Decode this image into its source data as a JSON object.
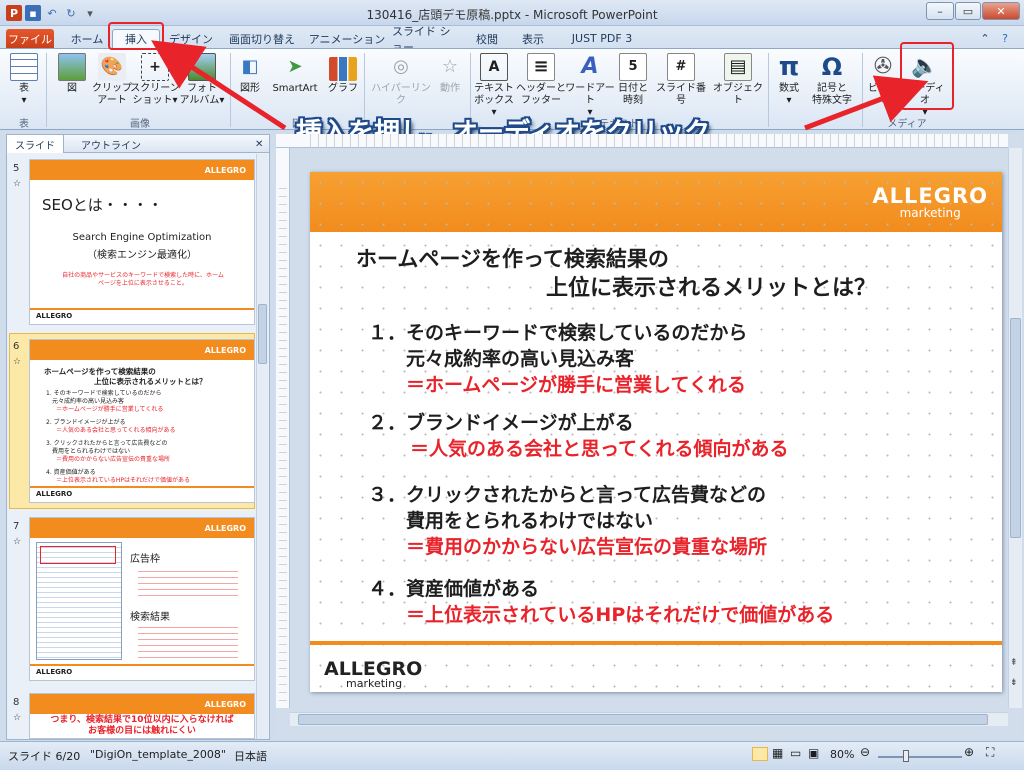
{
  "window": {
    "title": "130416_店頭デモ原稿.pptx  -  Microsoft PowerPoint"
  },
  "tabs": [
    "ファイル",
    "ホーム",
    "挿入",
    "デザイン",
    "画面切り替え",
    "アニメーション",
    "スライド ショー",
    "校閲",
    "表示",
    "JUST PDF 3"
  ],
  "ribbon": {
    "buttons": {
      "table": "表",
      "picture": "図",
      "clipart": "クリップ\nアート",
      "screenshot": "スクリーン\nショット▾",
      "photoalbum": "フォト\nアルバム▾",
      "shapes": "図形",
      "smartart": "SmartArt",
      "chart": "グラフ",
      "hyperlink": "ハイパーリンク",
      "action": "動作",
      "textbox": "テキスト\nボックス▾",
      "headerfooter": "ヘッダーと\nフッター",
      "wordart": "ワードアート\n▾",
      "datetime": "日付と\n時刻",
      "slidenumber": "スライド番号",
      "object": "オブジェクト",
      "equation": "数式\n▾",
      "symbol": "記号と\n特殊文字",
      "video": "ビデオ\n▾",
      "audio": "オーディオ\n▾"
    },
    "groups": {
      "table": "表",
      "images": "画像",
      "illustrations": "図",
      "links": "リンク",
      "text": "テキスト",
      "symbols": "記号と特殊文字",
      "media": "メディア"
    }
  },
  "callout": "挿入を押し、オーディオをクリック",
  "pane": {
    "tabs": [
      "スライド",
      "アウトライン"
    ],
    "thumbs": [
      {
        "num": "5",
        "title": "SEOとは・・・・",
        "sub1": "Search Engine Optimization",
        "sub2": "（検索エンジン最適化）",
        "red": "自社の商品やサービスのキーワードで検索した時に、ホームページを上位に表示させること。"
      },
      {
        "num": "6",
        "title": "ホームページを作って検索結果の",
        "title2": "上位に表示されるメリットとは？",
        "l1": "1. そのキーワードで検索しているのだから",
        "l1b": "元々成約率の高い見込み客",
        "l1r": "＝ホームページが勝手に営業してくれる",
        "l2": "2. ブランドイメージが上がる",
        "l2r": "＝人気のある会社と思ってくれる傾向がある",
        "l3": "3. クリックされたからと言って広告費などの",
        "l3b": "費用をとられるわけではない",
        "l3r": "＝費用のかからない広告宣伝の貴重な場所",
        "l4": "4. 資産価値がある",
        "l4r": "＝上位表示されているHPはそれだけで価値がある"
      },
      {
        "num": "7",
        "ad": "広告枠",
        "search": "検索結果"
      },
      {
        "num": "8",
        "red": "つまり、検索結果で10位以内に入らなければ",
        "red2": "お客様の目には触れにくい"
      }
    ]
  },
  "slide": {
    "logo": "ALLEGRO",
    "logo_sub": "marketing",
    "title1": "ホームページを作って検索結果の",
    "title2": "上位に表示されるメリットとは？",
    "items": [
      {
        "l1": "１．そのキーワードで検索しているのだから",
        "l2": "元々成約率の高い見込み客",
        "r": "＝ホームページが勝手に営業してくれる"
      },
      {
        "l1": "２．ブランドイメージが上がる",
        "r": "＝人気のある会社と思ってくれる傾向がある"
      },
      {
        "l1": "３．クリックされたからと言って広告費などの",
        "l2": "費用をとられるわけではない",
        "r": "＝費用のかからない広告宣伝の貴重な場所"
      },
      {
        "l1": "４．資産価値がある",
        "r": "＝上位表示されているHPはそれだけで価値がある"
      }
    ]
  },
  "status": {
    "slide": "スライド 6/20",
    "template": "\"DigiOn_template_2008\"",
    "lang": "日本語",
    "zoom": "80%"
  },
  "colors": {
    "accent": "#f28c1e",
    "red": "#e8232a",
    "callout_outline": "#1f4a8a"
  }
}
